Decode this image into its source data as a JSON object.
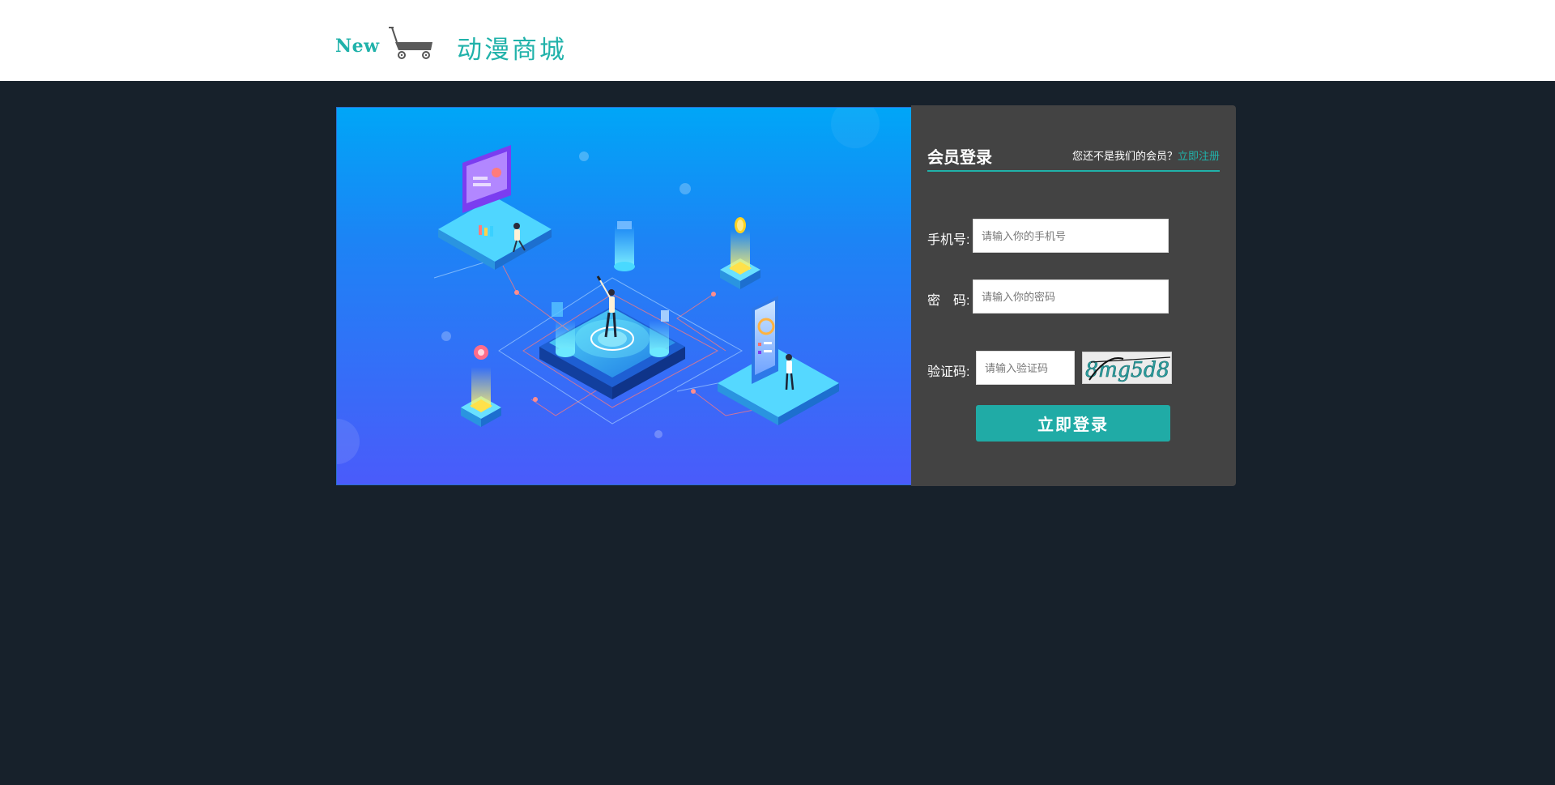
{
  "header": {
    "logo_new": "New",
    "site_name": "动漫商城"
  },
  "login": {
    "title": "会员登录",
    "register_prompt": "您还不是我们的会员？",
    "register_link": "立即注册",
    "phone_label": "手机号:",
    "phone_placeholder": "请输入你的手机号",
    "password_label": "密　码:",
    "password_placeholder": "请输入你的密码",
    "captcha_label": "验证码:",
    "captcha_placeholder": "请输入验证码",
    "captcha_text": "8mg5d8",
    "submit_label": "立即登录"
  },
  "colors": {
    "accent": "#20b2aa",
    "page_background": "#17212b",
    "panel_background": "#434343"
  },
  "icons": {
    "logo_cart": "shopping-cart-icon"
  }
}
